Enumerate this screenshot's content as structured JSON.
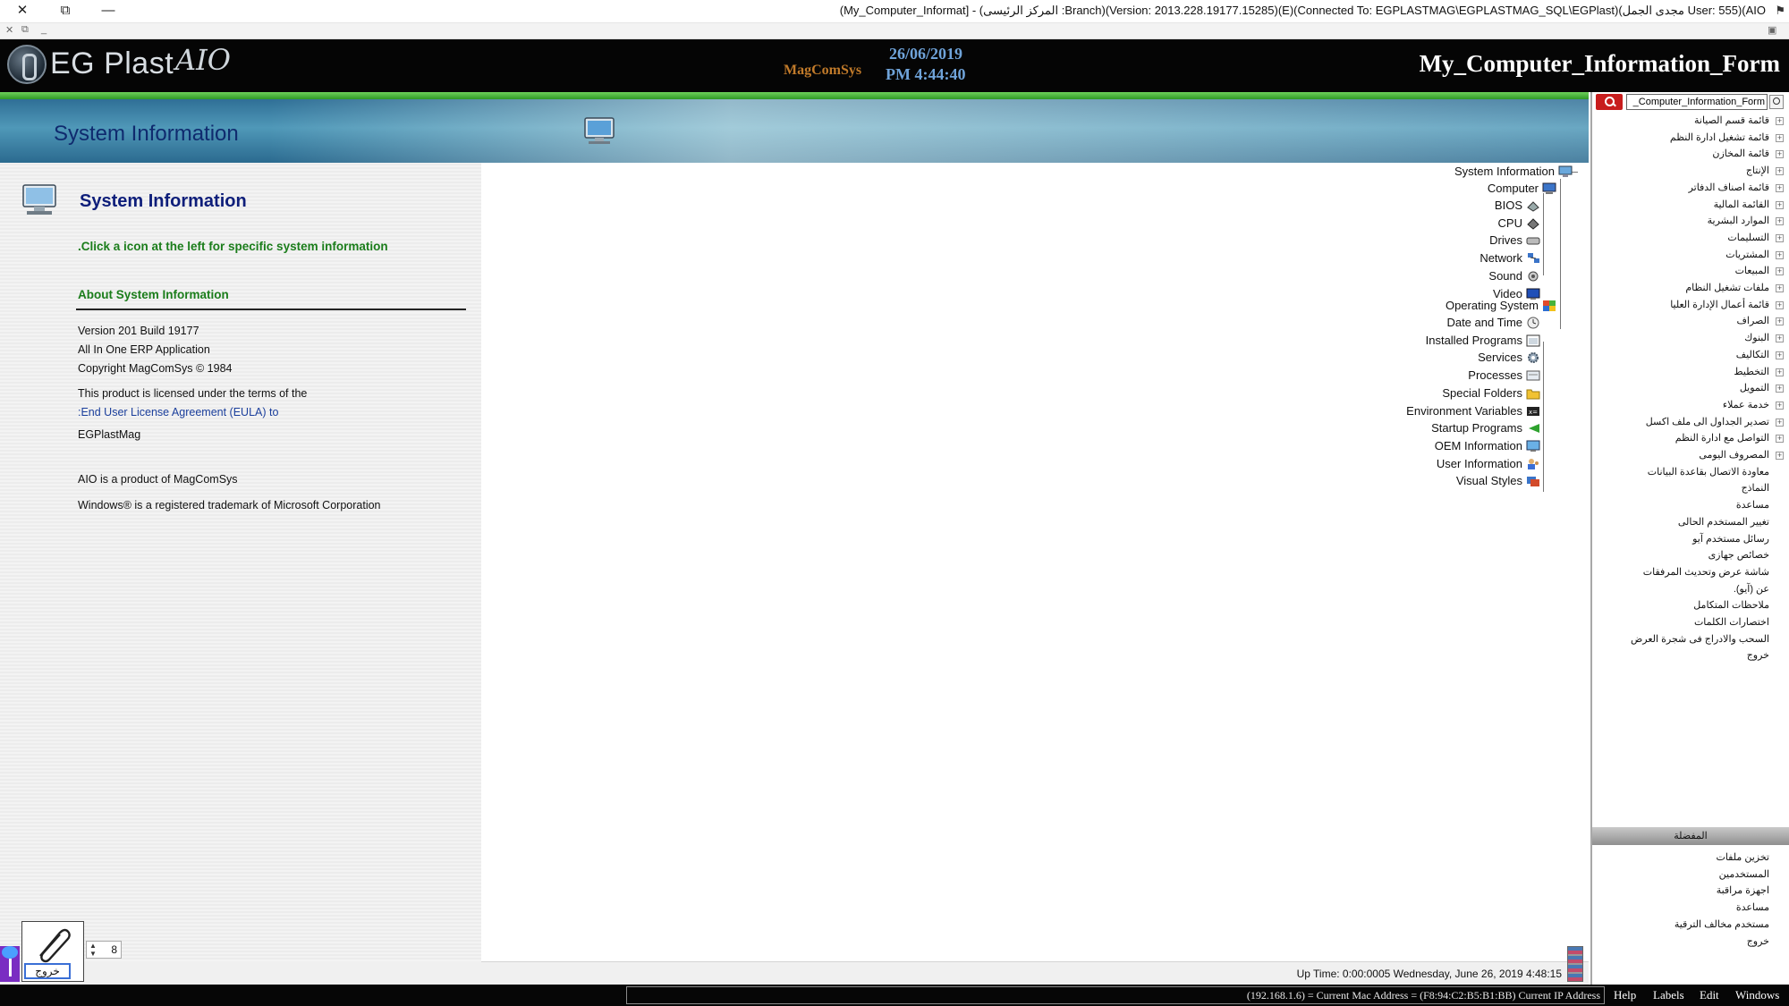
{
  "window": {
    "title": "(My_Computer_Informat] - (المركز الرئيسى :Branch)(Version: 2013.228.19177.15285)(E)(Connected To: EGPLASTMAG\\EGPLASTMAG_SQL\\EGPlast)(مجدى الجمل User: 555)(AIO",
    "close_glyph": "✕",
    "restore_glyph": "⧉",
    "minimize_glyph": "—"
  },
  "mdi": {
    "close": "✕",
    "restore": "⧉",
    "min": "_"
  },
  "header": {
    "logo_text": "EG Plast",
    "logo_script": "AIO",
    "brand": "MagComSys",
    "date": "26/06/2019",
    "time": "PM 4:44:40",
    "form_name": "My_Computer_Information_Form"
  },
  "banner": {
    "title": "System Information"
  },
  "info_panel": {
    "title": "System Information",
    "instruction": ".Click a icon at the left for specific system information",
    "about_heading": "About System Information",
    "version": "Version 201 Build 19177",
    "product": "All In One ERP Application",
    "copyright": "Copyright MagComSys ©  1984",
    "license_line": " This product is licensed under the terms of the",
    "eula_link": ":End User License Agreement (EULA) to",
    "licensee": "EGPlastMag",
    "aio_note": "AIO is a product of MagComSys",
    "trademark": "Windows® is a registered trademark of Microsoft Corporation"
  },
  "tree": {
    "root": {
      "label": "System Information",
      "icon": "system-info-icon"
    },
    "computer": {
      "label": "Computer",
      "icon": "computer-icon"
    },
    "computer_children": [
      {
        "label": "BIOS",
        "icon": "bios-chip-icon"
      },
      {
        "label": "CPU",
        "icon": "cpu-icon"
      },
      {
        "label": "Drives",
        "icon": "drive-icon"
      },
      {
        "label": "Network",
        "icon": "network-icon"
      },
      {
        "label": "Sound",
        "icon": "sound-icon"
      },
      {
        "label": "Video",
        "icon": "video-icon"
      }
    ],
    "os": {
      "label": "Operating System",
      "icon": "os-icon"
    },
    "os_children": [
      {
        "label": "Date and Time",
        "icon": "clock-icon"
      },
      {
        "label": "Installed Programs",
        "icon": "programs-icon"
      },
      {
        "label": "Services",
        "icon": "gear-icon"
      },
      {
        "label": "Processes",
        "icon": "processes-icon"
      },
      {
        "label": "Special Folders",
        "icon": "folder-icon"
      },
      {
        "label": "Environment Variables",
        "icon": "env-icon"
      },
      {
        "label": "Startup Programs",
        "icon": "startup-arrow-icon"
      },
      {
        "label": "OEM Information",
        "icon": "oem-icon"
      },
      {
        "label": "User Information",
        "icon": "user-icon"
      },
      {
        "label": "Visual Styles",
        "icon": "styles-icon"
      }
    ]
  },
  "side_menu": {
    "search_value": "_Computer_Information_Form",
    "items": [
      {
        "label": "قائمة قسم الصيانة",
        "expand": "+"
      },
      {
        "label": "قائمة تشغيل ادارة النظم",
        "expand": "+"
      },
      {
        "label": "قائمة المخازن",
        "expand": "+"
      },
      {
        "label": "الإنتاج",
        "expand": "+"
      },
      {
        "label": "قائمة اصناف الدفاتر",
        "expand": "+"
      },
      {
        "label": "القائمة المالية",
        "expand": "+"
      },
      {
        "label": "الموارد البشرية",
        "expand": "+"
      },
      {
        "label": "التسليمات",
        "expand": "+"
      },
      {
        "label": "المشتريات",
        "expand": "+"
      },
      {
        "label": "المبيعات",
        "expand": "+"
      },
      {
        "label": "ملفات تشغيل النظام",
        "expand": "+"
      },
      {
        "label": "قائمة أعمال الإدارة العليا",
        "expand": "+"
      },
      {
        "label": "الصراف",
        "expand": "+"
      },
      {
        "label": "البنوك",
        "expand": "+"
      },
      {
        "label": "التكاليف",
        "expand": "+"
      },
      {
        "label": "التخطيط",
        "expand": "+"
      },
      {
        "label": "التمويل",
        "expand": "+"
      },
      {
        "label": "خدمة عملاء",
        "expand": "+"
      },
      {
        "label": "تصدير الجداول الى ملف اكسل",
        "expand": "+"
      },
      {
        "label": "التواصل مع ادارة النظم",
        "expand": "+"
      },
      {
        "label": "المصروف اليومى",
        "expand": "+"
      },
      {
        "label": "معاودة الاتصال بقاعدة البيانات",
        "expand": ""
      },
      {
        "label": "النماذج",
        "expand": ""
      },
      {
        "label": "مساعدة",
        "expand": ""
      },
      {
        "label": "تغيير المستخدم الحالى",
        "expand": ""
      },
      {
        "label": "رسائل مستخدم آيو",
        "expand": ""
      },
      {
        "label": "خصائص جهازى",
        "expand": ""
      },
      {
        "label": "شاشة عرض وتحديث المرفقات",
        "expand": ""
      },
      {
        "label": "عن (آيو).",
        "expand": ""
      },
      {
        "label": "ملاحظات المتكامل",
        "expand": ""
      },
      {
        "label": "اختصارات الكلمات",
        "expand": ""
      },
      {
        "label": "السحب والادراج فى شجرة العرض",
        "expand": ""
      },
      {
        "label": "خروج",
        "expand": ""
      }
    ],
    "favorites_header": "المفضلة",
    "favorites": [
      {
        "label": "تخزين ملفات"
      },
      {
        "label": "المستخدمين"
      },
      {
        "label": "اجهزة مراقبة"
      },
      {
        "label": "مساعدة"
      },
      {
        "label": "مستخدم مخالف الترقية"
      },
      {
        "label": "خروج"
      }
    ]
  },
  "status": {
    "uptime": "Up Time: 0:00:0005  Wednesday, June 26, 2019  4:48:15",
    "spinner_value": "8",
    "exit_label": "خروج",
    "spin_up": "▲",
    "spin_down": "▼"
  },
  "bottom_bar": {
    "ip_text": "(192.168.1.6) = Current Mac Address = (F8:94:C2:B5:B1:BB) Current IP Address",
    "menu": [
      "Help",
      "Labels",
      "Edit",
      "Windows"
    ]
  },
  "colors": {
    "header_bg": "#050505",
    "accent_green": "#2f9a25",
    "banner_blue": "#2f6f96",
    "title_navy": "#0e1e7a",
    "link_green": "#1b7d1b",
    "search_red": "#c81d1d"
  }
}
